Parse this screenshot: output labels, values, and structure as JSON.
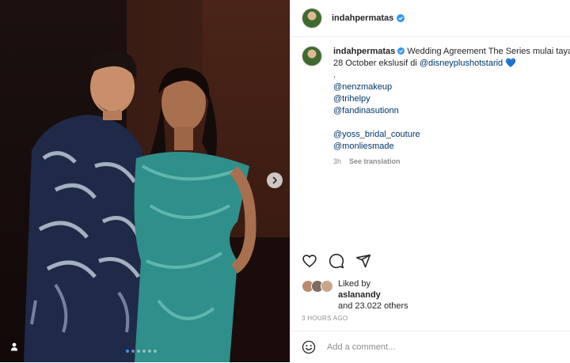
{
  "post": {
    "username": "indahpermatas",
    "verified": true
  },
  "caption": {
    "username": "indahpermatas",
    "text_line1": "Wedding Agreement The Series mulai taya",
    "text_line2_prefix": "28 October ekslusif di ",
    "disney_mention": "@disneyplushotstarid",
    "heart": "💙",
    "dot": ".",
    "mentions": [
      "@nenzmakeup",
      "@trihelpy",
      "@fandinasutionn"
    ],
    "mentions2": [
      "@yoss_bridal_couture",
      "@monliesmade"
    ],
    "age": "3h",
    "see_translation": "See translation"
  },
  "likes": {
    "liked_by": "Liked by",
    "user": "aslanandy",
    "others": "and 23.022 others"
  },
  "timestamp": "3 HOURS AGO",
  "comment": {
    "placeholder": "Add a comment..."
  },
  "carousel": {
    "total_slides": 6,
    "active_slide": 1
  },
  "colors": {
    "verified": "#3897f0",
    "link": "#00376b",
    "muted": "#8e8e8e",
    "dress": "#2f8f8a"
  },
  "icons": [
    "heart-icon",
    "comment-icon",
    "share-icon",
    "emoji-icon",
    "chevron-right-icon",
    "user-tag-icon",
    "verified-icon"
  ]
}
